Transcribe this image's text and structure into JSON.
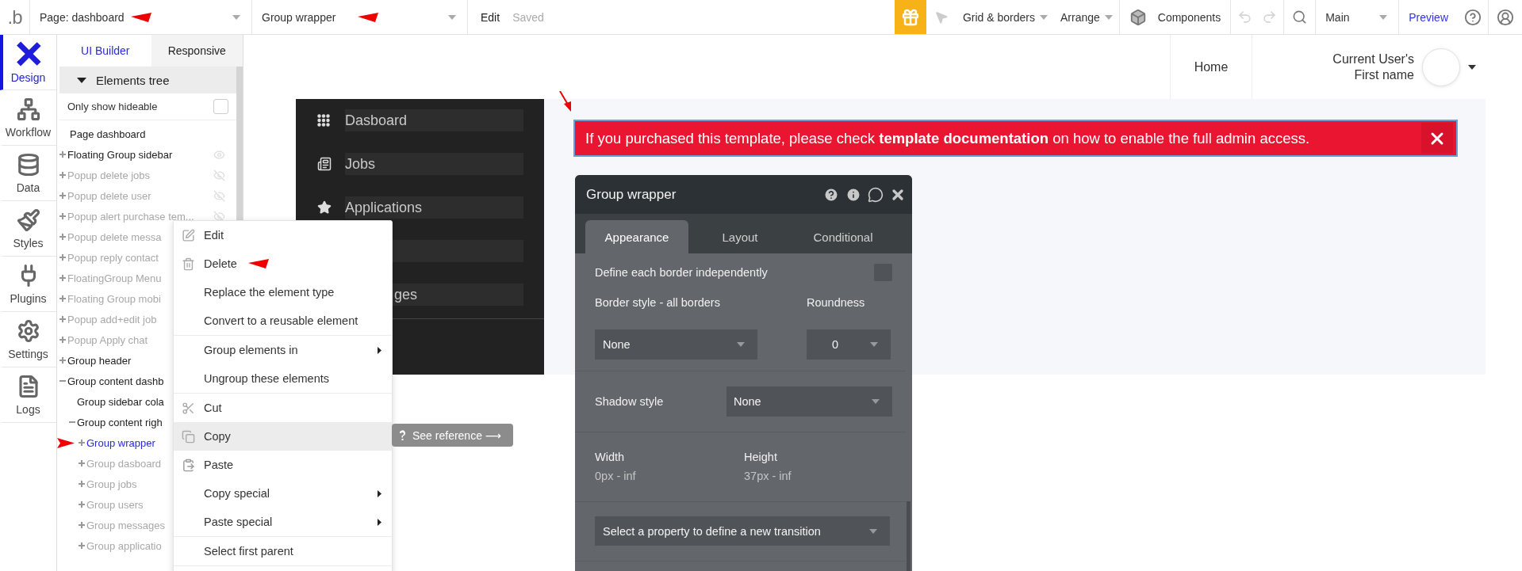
{
  "topbar": {
    "logo": ".b",
    "page_selector": "Page: dashboard",
    "element_selector": "Group wrapper",
    "edit": "Edit",
    "save_status": "Saved",
    "grid_menu": "Grid & borders",
    "arrange_menu": "Arrange",
    "components": "Components",
    "version_selector": "Main",
    "preview": "Preview"
  },
  "rail": [
    {
      "label": "Design",
      "selected": true
    },
    {
      "label": "Workflow",
      "selected": false
    },
    {
      "label": "Data",
      "selected": false
    },
    {
      "label": "Styles",
      "selected": false
    },
    {
      "label": "Plugins",
      "selected": false
    },
    {
      "label": "Settings",
      "selected": false
    },
    {
      "label": "Logs",
      "selected": false
    }
  ],
  "panel": {
    "tabs": [
      {
        "label": "UI Builder",
        "selected": true
      },
      {
        "label": "Responsive",
        "selected": false
      }
    ],
    "section": {
      "label": "Elements tree",
      "expanded": true
    },
    "filter": {
      "label": "Only show hideable",
      "checked": false
    },
    "page": "Page dashboard",
    "tree": [
      {
        "label": "Floating Group sidebar",
        "hidden": false,
        "selected": false,
        "expanded": false,
        "eye": true
      },
      {
        "label": "Popup delete jobs",
        "hidden": true,
        "selected": false,
        "expanded": false,
        "eye": true
      },
      {
        "label": "Popup delete user",
        "hidden": true,
        "selected": false,
        "expanded": false,
        "eye": true
      },
      {
        "label": "Popup alert purchase tem...",
        "hidden": true,
        "selected": false,
        "expanded": false,
        "eye": true
      },
      {
        "label": "Popup delete messa",
        "hidden": true,
        "selected": false,
        "expanded": false
      },
      {
        "label": "Popup reply contact",
        "hidden": true,
        "selected": false,
        "expanded": false
      },
      {
        "label": "FloatingGroup Menu",
        "hidden": true,
        "selected": false,
        "expanded": false
      },
      {
        "label": "Floating Group mobi",
        "hidden": true,
        "selected": false,
        "expanded": false
      },
      {
        "label": "Popup add+edit job",
        "hidden": true,
        "selected": false,
        "expanded": false
      },
      {
        "label": "Popup Apply chat",
        "hidden": true,
        "selected": false,
        "expanded": false
      },
      {
        "label": "Group header",
        "hidden": false,
        "selected": false,
        "expanded": false
      },
      {
        "label": "Group content dashb",
        "hidden": false,
        "selected": false,
        "expanded": true,
        "children": [
          {
            "label": "Group sidebar cola",
            "hidden": false,
            "selected": false
          },
          {
            "label": "Group content righ",
            "hidden": false,
            "selected": false,
            "expanded": true,
            "children": [
              {
                "label": "Group wrapper",
                "hidden": false,
                "selected": true,
                "expanded": false
              },
              {
                "label": "Group dasboard",
                "hidden": true,
                "selected": false,
                "expanded": false
              },
              {
                "label": "Group jobs",
                "hidden": true,
                "selected": false,
                "expanded": false
              },
              {
                "label": "Group users",
                "hidden": true,
                "selected": false,
                "expanded": false
              },
              {
                "label": "Group messages",
                "hidden": true,
                "selected": false,
                "expanded": false
              },
              {
                "label": "Group applicatio",
                "hidden": true,
                "selected": false,
                "expanded": false
              }
            ]
          }
        ]
      }
    ]
  },
  "context_menu": {
    "groups": [
      [
        {
          "label": "Edit",
          "highlighted": false,
          "submenu": false
        },
        {
          "label": "Delete",
          "highlighted": false,
          "submenu": false
        },
        {
          "label": "Replace the element type",
          "highlighted": false,
          "submenu": false
        },
        {
          "label": "Convert to a reusable element",
          "highlighted": false,
          "submenu": false
        }
      ],
      [
        {
          "label": "Group elements in",
          "highlighted": false,
          "submenu": true
        },
        {
          "label": "Ungroup these elements",
          "highlighted": false,
          "submenu": false
        }
      ],
      [
        {
          "label": "Cut",
          "highlighted": false,
          "submenu": false
        },
        {
          "label": "Copy",
          "highlighted": true,
          "submenu": false
        },
        {
          "label": "Paste",
          "highlighted": false,
          "submenu": false
        },
        {
          "label": "Copy special",
          "highlighted": false,
          "submenu": true
        },
        {
          "label": "Paste special",
          "highlighted": false,
          "submenu": true
        }
      ],
      [
        {
          "label": "Select first parent",
          "highlighted": false,
          "submenu": false
        }
      ]
    ]
  },
  "reference_tooltip": "See reference ⟶",
  "preview": {
    "header": {
      "home": "Home",
      "user_name": "Current User's First name"
    },
    "sidebar": [
      {
        "kind": "item",
        "label": "Dasboard"
      },
      {
        "kind": "item",
        "label": "Jobs"
      },
      {
        "kind": "item",
        "label": "Applications"
      },
      {
        "kind": "blank"
      },
      {
        "kind": "partial",
        "label": "ges"
      }
    ],
    "banner": {
      "text": "If you purchased this template, please check **template documentation** on how to enable the full admin access.",
      "selected": true
    }
  },
  "property_editor": {
    "title": "Group wrapper",
    "tabs": [
      {
        "label": "Appearance",
        "selected": true
      },
      {
        "label": "Layout",
        "selected": false
      },
      {
        "label": "Conditional",
        "selected": false
      }
    ],
    "independent_borders": {
      "label": "Define each border independently",
      "checked": false
    },
    "border_style": {
      "label": "Border style - all borders",
      "value": "None"
    },
    "roundness": {
      "label": "Roundness",
      "value": "0"
    },
    "shadow_style": {
      "label": "Shadow style",
      "value": "None"
    },
    "width": {
      "label": "Width",
      "value": "0px - inf"
    },
    "height": {
      "label": "Height",
      "value": "37px - inf"
    },
    "transition": {
      "prompt": "Select a property to define a new transition"
    }
  }
}
